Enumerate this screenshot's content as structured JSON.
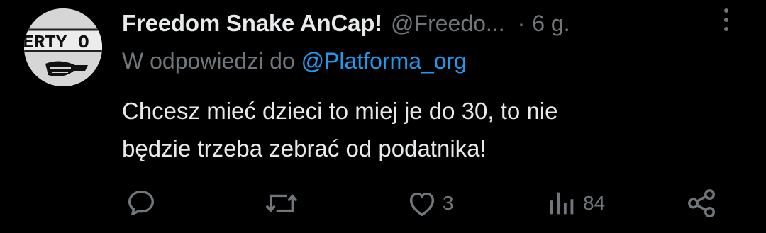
{
  "tweet": {
    "display_name": "Freedom Snake AnCap!",
    "handle": "@Freedo...",
    "separator": "·",
    "time": "6 g.",
    "reply_prefix": "W odpowiedzi do",
    "reply_mention": "@Platforma_org",
    "text_line1": "Chcesz mieć dzieci to miej je do 30, to nie",
    "text_line2": "będzie trzeba zebrać od podatnika!",
    "avatar_text": "ERTY O"
  },
  "actions": {
    "reply": {
      "icon": "reply-icon",
      "count": ""
    },
    "retweet": {
      "icon": "retweet-icon",
      "count": ""
    },
    "like": {
      "icon": "heart-icon",
      "count": "3"
    },
    "views": {
      "icon": "views-icon",
      "count": "84"
    },
    "share": {
      "icon": "share-icon",
      "count": ""
    }
  },
  "colors": {
    "background": "#000000",
    "primary_text": "#e7e9ea",
    "secondary_text": "#71767b",
    "mention": "#1d9bf0"
  }
}
